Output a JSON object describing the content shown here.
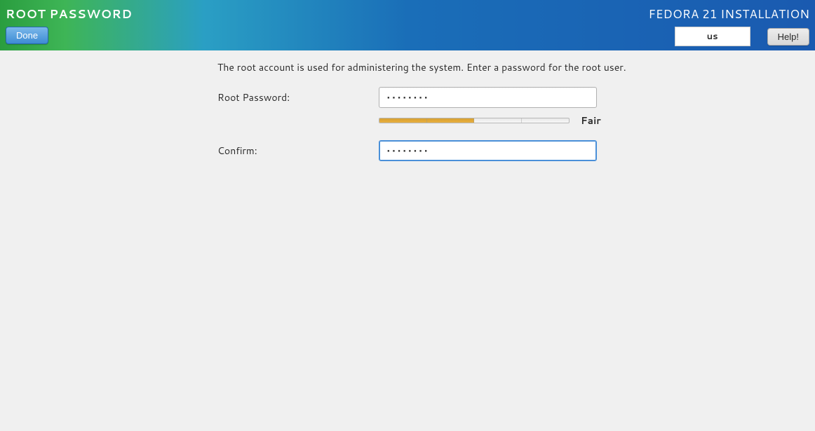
{
  "header": {
    "page_title": "ROOT PASSWORD",
    "installer_title": "FEDORA 21 INSTALLATION",
    "done_label": "Done",
    "help_label": "Help!",
    "keyboard_layout": "us"
  },
  "form": {
    "description": "The root account is used for administering the system.  Enter a password for the root user.",
    "password_label": "Root Password:",
    "confirm_label": "Confirm:",
    "password_value": "••••••••",
    "confirm_value": "••••••••",
    "strength_label": "Fair",
    "strength_segments": 4,
    "strength_filled": 2
  }
}
